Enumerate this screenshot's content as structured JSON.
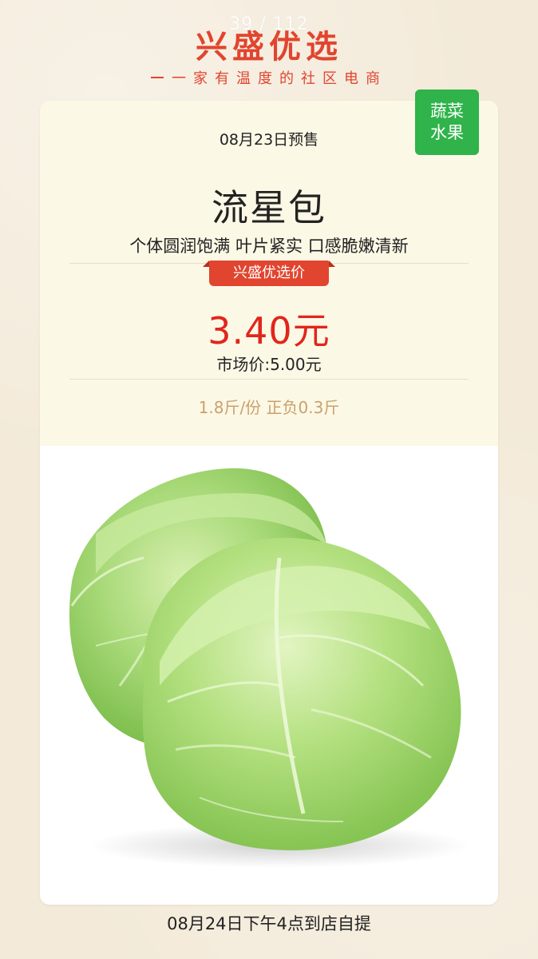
{
  "counter": "39 / 112",
  "brand": {
    "name": "兴盛优选",
    "slogan": "一家有温度的社区电商"
  },
  "category": {
    "line1": "蔬菜",
    "line2": "水果"
  },
  "product": {
    "presale_date": "08月23日预售",
    "name": "流星包",
    "description": "个体圆润饱满 叶片紧实 口感脆嫩清新",
    "price_tag_label": "兴盛优选价",
    "current_price": "3.40元",
    "market_price": "市场价:5.00元",
    "spec": "1.8斤/份 正负0.3斤",
    "image_icon": "cabbage-image"
  },
  "pickup": "08月24日下午4点到店自提",
  "colors": {
    "brand_red": "#e1452f",
    "price_red": "#e1261c",
    "category_green": "#2fb34a",
    "spec_tan": "#c9a16d",
    "card_bg": "#fcf8e6",
    "page_bg": "#f3ead9"
  }
}
